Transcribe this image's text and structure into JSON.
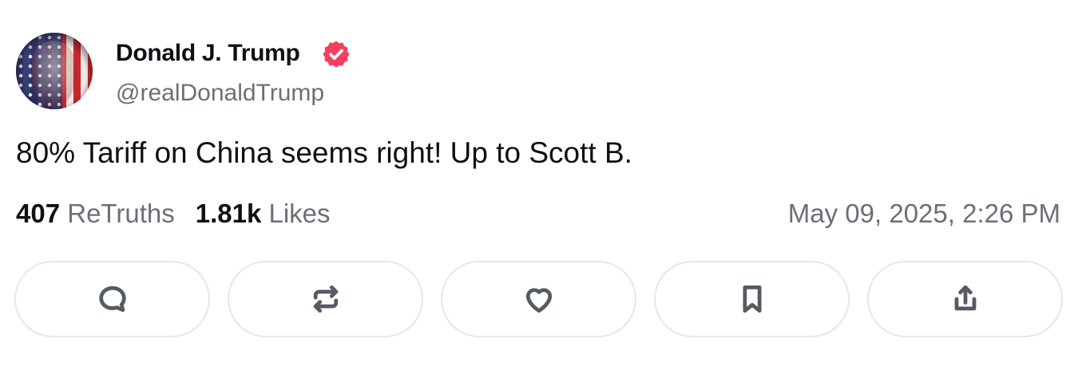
{
  "author": {
    "display_name": "Donald J. Trump",
    "handle": "@realDonaldTrump",
    "verified_icon": "verified-badge-icon",
    "verified_color": "#f43f5e"
  },
  "post": {
    "text": "80% Tariff on China seems right! Up to Scott B."
  },
  "stats": {
    "retruths_count": "407",
    "retruths_label": "ReTruths",
    "likes_count": "1.81k",
    "likes_label": "Likes",
    "timestamp": "May 09, 2025, 2:26 PM"
  },
  "actions": [
    {
      "name": "reply",
      "icon": "comment-icon"
    },
    {
      "name": "retruth",
      "icon": "repost-icon"
    },
    {
      "name": "like",
      "icon": "heart-icon"
    },
    {
      "name": "bookmark",
      "icon": "bookmark-icon"
    },
    {
      "name": "share",
      "icon": "share-icon"
    }
  ]
}
